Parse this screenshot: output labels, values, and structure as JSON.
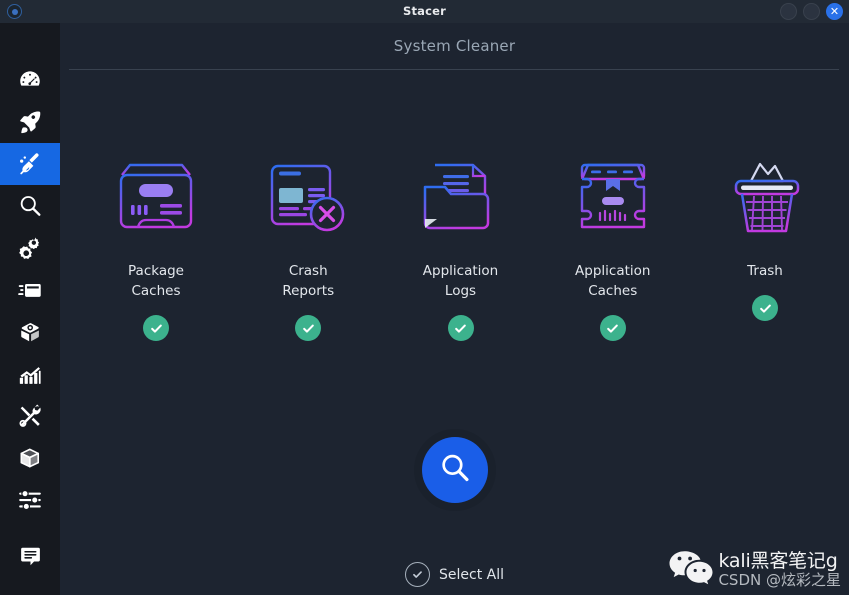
{
  "window": {
    "title": "Stacer",
    "app_icon": "stacer-logo-icon",
    "controls": [
      {
        "name": "minimize-button",
        "glyph": ""
      },
      {
        "name": "maximize-button",
        "glyph": ""
      },
      {
        "name": "close-button",
        "glyph": "✕"
      }
    ]
  },
  "sidebar": {
    "items": [
      {
        "name": "sidebar-item-dashboard",
        "icon": "gauge-icon",
        "active": false
      },
      {
        "name": "sidebar-item-startup-apps",
        "icon": "rocket-icon",
        "active": false
      },
      {
        "name": "sidebar-item-system-cleaner",
        "icon": "broom-icon",
        "active": true
      },
      {
        "name": "sidebar-item-search",
        "icon": "magnifier-icon",
        "active": false
      },
      {
        "name": "sidebar-item-services",
        "icon": "gears-icon",
        "active": false
      },
      {
        "name": "sidebar-item-processes",
        "icon": "processes-icon",
        "active": false
      },
      {
        "name": "sidebar-item-uninstaller",
        "icon": "uninstaller-icon",
        "active": false
      },
      {
        "name": "sidebar-item-resources",
        "icon": "bar-chart-icon",
        "active": false
      },
      {
        "name": "sidebar-item-apt-repository",
        "icon": "tools-icon",
        "active": false
      },
      {
        "name": "sidebar-item-packages",
        "icon": "box-icon",
        "active": false
      },
      {
        "name": "sidebar-item-settings",
        "icon": "sliders-icon",
        "active": false
      },
      {
        "name": "sidebar-item-feedback",
        "icon": "speech-bubble-icon",
        "active": false
      }
    ]
  },
  "page": {
    "title": "System Cleaner"
  },
  "cleaner": {
    "cards": [
      {
        "name": "card-package-caches",
        "icon": "package-box-icon",
        "label": "Package\nCaches",
        "checked": true
      },
      {
        "name": "card-crash-reports",
        "icon": "document-error-icon",
        "label": "Crash\nReports",
        "checked": true
      },
      {
        "name": "card-application-logs",
        "icon": "folder-document-icon",
        "label": "Application\nLogs",
        "checked": true
      },
      {
        "name": "card-application-caches",
        "icon": "chest-box-icon",
        "label": "Application\nCaches",
        "checked": true
      },
      {
        "name": "card-trash",
        "icon": "trash-bin-icon",
        "label": "Trash",
        "checked": true
      }
    ],
    "scan_button": {
      "name": "scan-button",
      "icon": "magnifier-icon",
      "label": ""
    },
    "select_all": {
      "name": "select-all-toggle",
      "label": "Select All",
      "checked": true
    }
  },
  "watermark": {
    "icon": "wechat-icon",
    "line1": "kali黑客笔记g",
    "line2": "CSDN @炫彩之星"
  },
  "colors": {
    "accent_blue": "#1a5ee8",
    "sidebar_active": "#1668e3",
    "check_green": "#3cb28d",
    "titlebar_bg": "#222a35",
    "sidebar_bg": "#16191f",
    "content_bg": "#1d2430",
    "close_button": "#2a71e8"
  }
}
